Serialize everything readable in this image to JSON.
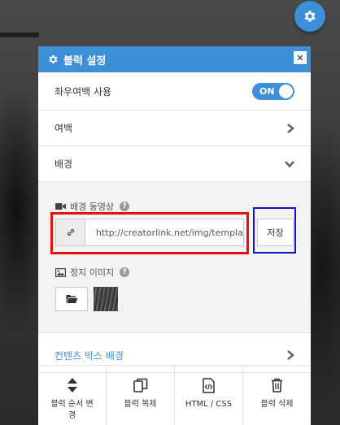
{
  "panel": {
    "title": "블럭 설정",
    "close_label": "✕"
  },
  "rows": {
    "side_margin": {
      "label": "좌우여백 사용",
      "toggle": "ON"
    },
    "margin": {
      "label": "여백"
    },
    "background": {
      "label": "배경"
    }
  },
  "background_section": {
    "video_label": "배경 동영상",
    "video_help": "?",
    "url_value": "http://creatorlink.net/img/templa",
    "save_label": "저장",
    "image_label": "정지 이미지",
    "image_help": "?"
  },
  "content_box_bg": {
    "label": "컨텐츠 박스 배경"
  },
  "footer": {
    "move_label": "블럭 순서 변경",
    "copy_label": "블럭 복제",
    "html_label": "HTML / CSS",
    "delete_label": "블럭 삭제"
  },
  "colors": {
    "accent": "#3d8fd8",
    "highlight_red": "#e8100f",
    "highlight_blue": "#1412c7"
  }
}
